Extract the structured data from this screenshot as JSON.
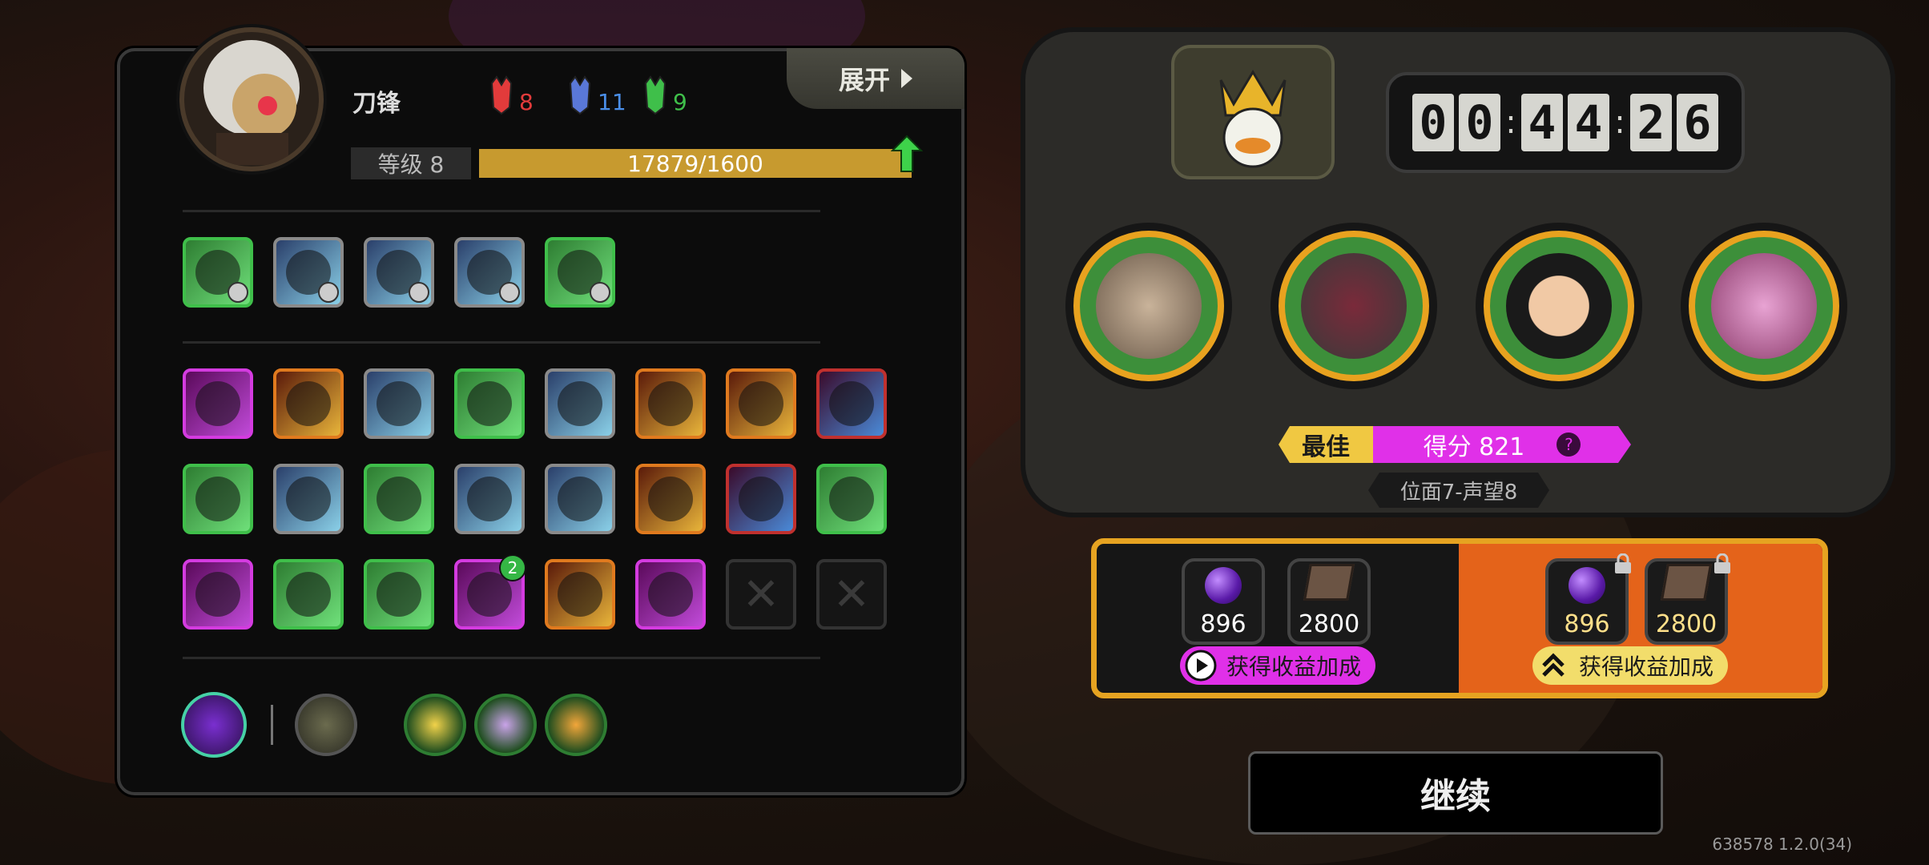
{
  "character": {
    "name": "刀锋",
    "level_label": "等级 8",
    "xp_text": "17879/1600"
  },
  "expand_button": {
    "label": "展开"
  },
  "resources": [
    {
      "icon": "red-mask-icon",
      "count": "8",
      "color": "#e23b3b"
    },
    {
      "icon": "blue-mask-icon",
      "count": "11",
      "color": "#4a8ee8"
    },
    {
      "icon": "green-mask-icon",
      "count": "9",
      "color": "#3fbf4a"
    }
  ],
  "equipment_slots": [
    {
      "icon": "claw-skill-icon",
      "rarity": "green"
    },
    {
      "icon": "triangle-blade-icon",
      "rarity": "gray"
    },
    {
      "icon": "chain-skill-icon",
      "rarity": "gray"
    },
    {
      "icon": "demon-helm-icon",
      "rarity": "gray"
    },
    {
      "icon": "green-beetle-icon",
      "rarity": "green"
    }
  ],
  "inventory_slots": [
    {
      "icon": "red-figure-icon",
      "rarity": "pink"
    },
    {
      "icon": "yellow-arrows-icon",
      "rarity": "orange"
    },
    {
      "icon": "purple-creature-icon",
      "rarity": "gray"
    },
    {
      "icon": "purple-cells-icon",
      "rarity": "green"
    },
    {
      "icon": "lightning-eye-icon",
      "rarity": "gray"
    },
    {
      "icon": "rune-coin-icon",
      "rarity": "orange"
    },
    {
      "icon": "claws-icon",
      "rarity": "orange"
    },
    {
      "icon": "green-shield-icon",
      "rarity": "red"
    },
    {
      "icon": "purple-hand-icon",
      "rarity": "green"
    },
    {
      "icon": "ribcage-icon",
      "rarity": "gray"
    },
    {
      "icon": "blue-slash-icon",
      "rarity": "green"
    },
    {
      "icon": "purple-pot-icon",
      "rarity": "gray"
    },
    {
      "icon": "serpent-icon",
      "rarity": "gray"
    },
    {
      "icon": "green-tooth-icon",
      "rarity": "orange"
    },
    {
      "icon": "masked-face-icon",
      "rarity": "red"
    },
    {
      "icon": "red-wolf-icon",
      "rarity": "green"
    },
    {
      "icon": "red-maw-icon",
      "rarity": "pink"
    },
    {
      "icon": "red-tentacle-icon",
      "rarity": "green"
    },
    {
      "icon": "blue-burst-icon",
      "rarity": "green"
    },
    {
      "icon": "purple-drip-icon",
      "rarity": "pink",
      "badge": "2"
    },
    {
      "icon": "dagger-icon",
      "rarity": "orange"
    },
    {
      "icon": "purple-gem-icon",
      "rarity": "pink"
    },
    {
      "icon": "empty-slot-icon",
      "rarity": "empty"
    },
    {
      "icon": "empty-slot-icon",
      "rarity": "empty"
    }
  ],
  "timer": {
    "digits": [
      "0",
      "0",
      "4",
      "4",
      "2",
      "6"
    ]
  },
  "heroes": [
    {
      "icon": "robot-mask-hero-icon"
    },
    {
      "icon": "hooded-bird-hero-icon"
    },
    {
      "icon": "curly-hair-glasses-hero-icon"
    },
    {
      "icon": "pink-brain-hero-icon"
    }
  ],
  "best": {
    "label": "最佳",
    "score_text": "得分 821",
    "help_icon": "?"
  },
  "stage": {
    "label": "位面7-声望8"
  },
  "rewards": {
    "free": [
      {
        "icon": "purple-orb-icon",
        "amount": "896"
      },
      {
        "icon": "book-icon",
        "amount": "2800"
      }
    ],
    "free_bonus": "获得收益加成",
    "locked": [
      {
        "icon": "purple-orb-icon",
        "amount": "896"
      },
      {
        "icon": "book-icon",
        "amount": "2800"
      }
    ],
    "locked_bonus": "获得收益加成"
  },
  "continue_label": "继续",
  "version": "638578 1.2.0(34)",
  "colors": {
    "gold": "#e6a321",
    "magenta": "#e030e8",
    "orange": "#e4631a",
    "green": "#3fbf4a"
  }
}
